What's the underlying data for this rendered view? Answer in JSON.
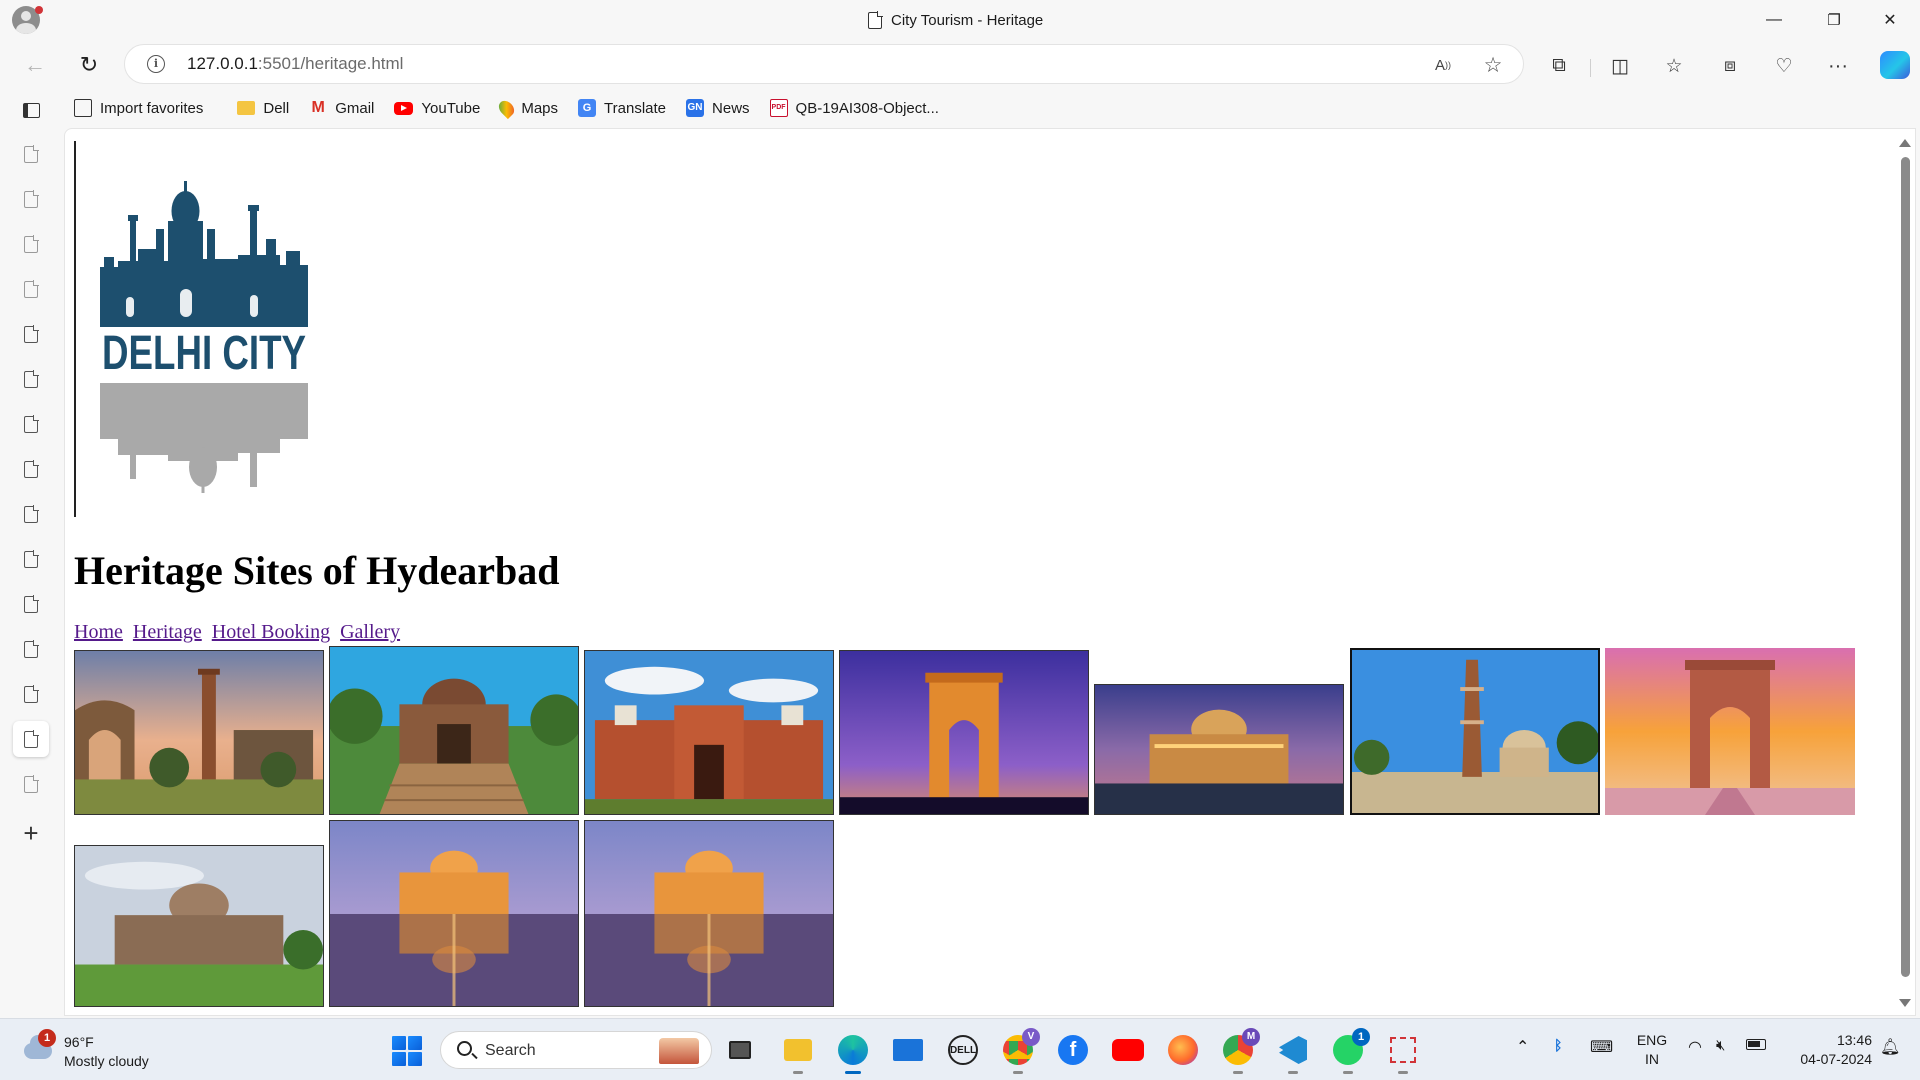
{
  "window": {
    "title": "City Tourism - Heritage",
    "controls": {
      "minimize": "—",
      "restore": "❐",
      "close": "✕"
    }
  },
  "address_bar": {
    "url_host": "127.0.0.1",
    "url_path": ":5501/heritage.html"
  },
  "favorites": [
    {
      "label": "Import favorites",
      "icon": "import-icon"
    },
    {
      "label": "Dell",
      "icon": "folder-icon"
    },
    {
      "label": "Gmail",
      "icon": "gmail-icon"
    },
    {
      "label": "YouTube",
      "icon": "youtube-icon"
    },
    {
      "label": "Maps",
      "icon": "maps-icon"
    },
    {
      "label": "Translate",
      "icon": "translate-icon"
    },
    {
      "label": "News",
      "icon": "news-icon"
    },
    {
      "label": "QB-19AI308-Object...",
      "icon": "pdf-icon"
    }
  ],
  "page": {
    "logo_text": "DELHI CITY",
    "heading": "Heritage Sites of Hydearbad",
    "nav": [
      {
        "label": "Home"
      },
      {
        "label": "Heritage"
      },
      {
        "label": "Hotel Booking"
      },
      {
        "label": "Gallery"
      }
    ]
  },
  "taskbar": {
    "weather_temp": "96°F",
    "weather_desc": "Mostly cloudy",
    "weather_badge": "1",
    "search_label": "Search",
    "whatsapp_badge": "1",
    "chrome_profile_badge_1": "V",
    "chrome_profile_badge_2": "M",
    "dell_label": "DELL",
    "lang_1": "ENG",
    "lang_2": "IN",
    "time": "13:46",
    "date": "04-07-2024"
  },
  "colors": {
    "logo_teal": "#1d4f6e",
    "logo_reflection": "#a9a9a9",
    "link_visited": "#551a8b",
    "accent": "#0067c0"
  }
}
